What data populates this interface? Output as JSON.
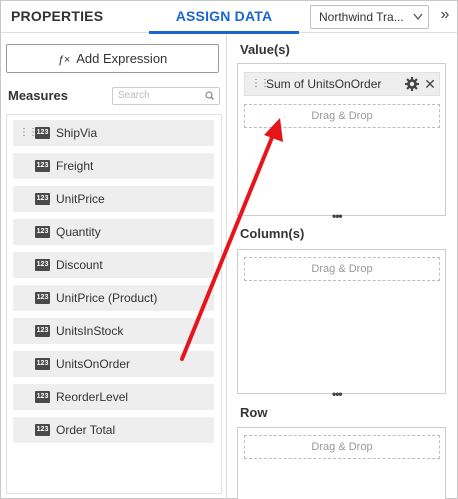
{
  "header": {
    "tab_properties": "PROPERTIES",
    "tab_assign_data": "ASSIGN DATA",
    "datasource_selected": "Northwind Tra...",
    "collapse_glyph": "»"
  },
  "left_pane": {
    "add_expression_icon": "ƒ×",
    "add_expression_label": "Add Expression",
    "measures_title": "Measures",
    "search_placeholder": "Search",
    "measure_type_badge": "123",
    "measures": [
      {
        "label": "ShipVia"
      },
      {
        "label": "Freight"
      },
      {
        "label": "UnitPrice"
      },
      {
        "label": "Quantity"
      },
      {
        "label": "Discount"
      },
      {
        "label": "UnitPrice (Product)"
      },
      {
        "label": "UnitsInStock"
      },
      {
        "label": "UnitsOnOrder"
      },
      {
        "label": "ReorderLevel"
      },
      {
        "label": "Order Total"
      }
    ]
  },
  "right_pane": {
    "values_title": "Value(s)",
    "value_item_label": "Sum of UnitsOnOrder",
    "columns_title": "Column(s)",
    "rows_title": "Row",
    "drag_drop_label": "Drag & Drop"
  },
  "colors": {
    "accent": "#1a66d1",
    "arrow": "#e8141c"
  }
}
